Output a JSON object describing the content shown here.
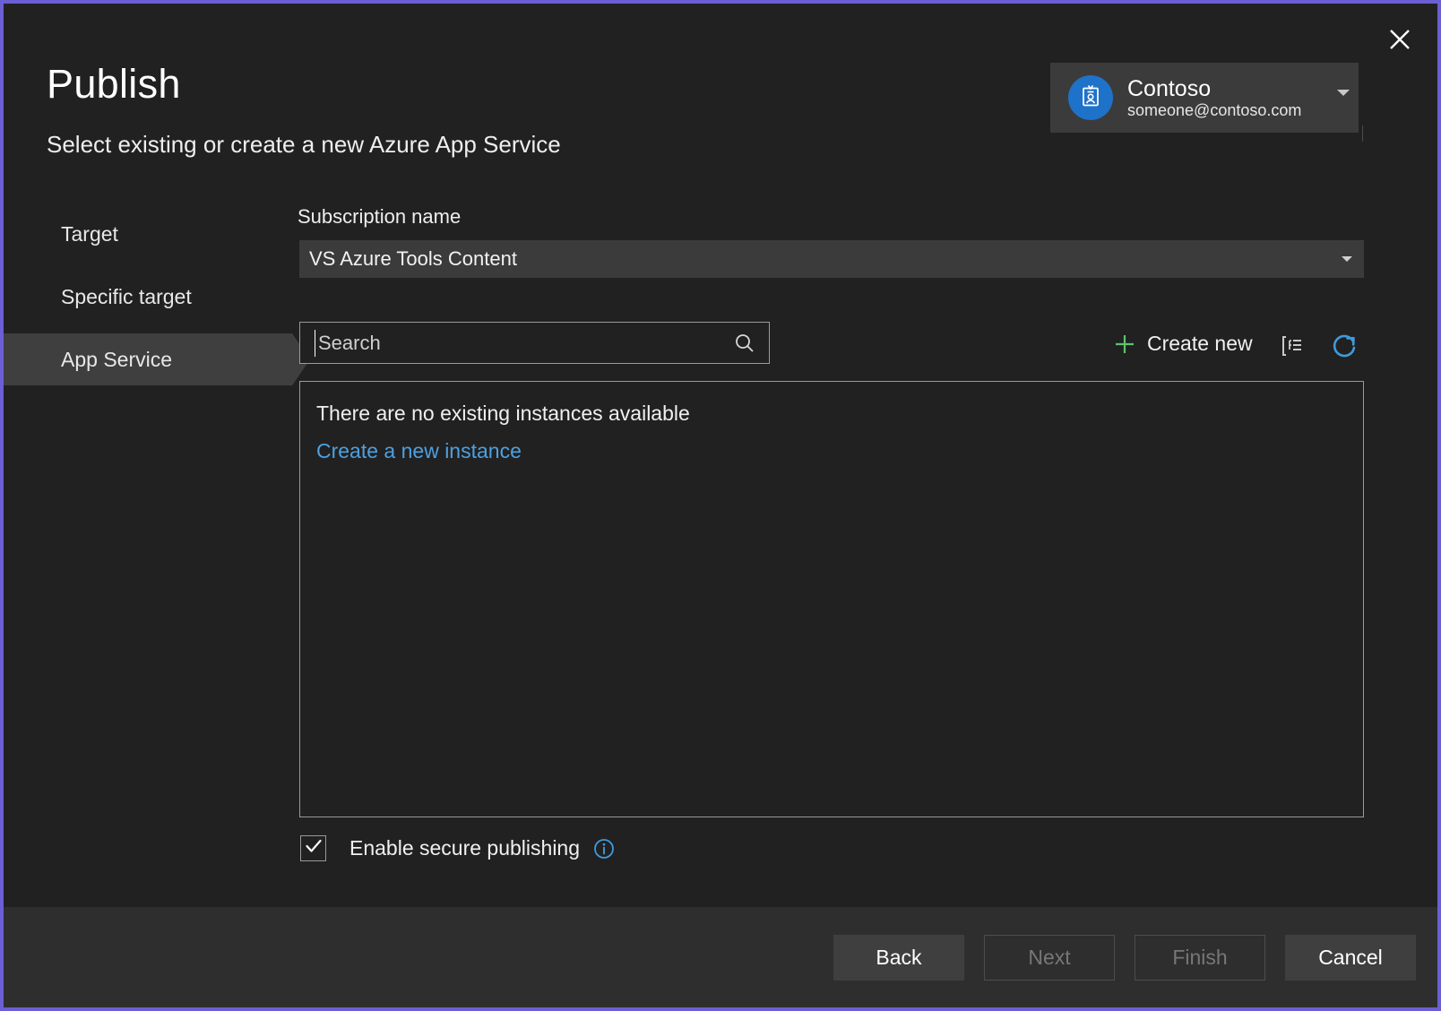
{
  "dialog": {
    "title": "Publish",
    "subtitle": "Select existing or create a new Azure App Service",
    "close_label": "Close"
  },
  "account": {
    "name": "Contoso",
    "email": "someone@contoso.com",
    "avatar_icon": "id-badge-icon",
    "caret_icon": "chevron-down-icon",
    "accent_color": "#1f72c9"
  },
  "nav": {
    "items": [
      {
        "label": "Target",
        "active": false
      },
      {
        "label": "Specific target",
        "active": false
      },
      {
        "label": "App Service",
        "active": true
      }
    ]
  },
  "subscription": {
    "label": "Subscription name",
    "value": "VS Azure Tools Content",
    "caret_icon": "chevron-down-icon"
  },
  "search": {
    "placeholder": "Search",
    "value": "",
    "icon": "search-icon"
  },
  "toolbar": {
    "create_new_label": "Create new",
    "plus_icon": "plus-icon",
    "plus_color": "#5cc46a",
    "group_icon": "group-by-icon",
    "refresh_icon": "refresh-icon",
    "refresh_color": "#3f9bdc"
  },
  "list": {
    "empty_message": "There are no existing instances available",
    "create_link": "Create a new instance",
    "link_color": "#4ea0e0"
  },
  "secure_publishing": {
    "label": "Enable secure publishing",
    "checked": true,
    "check_icon": "checkmark-icon",
    "info_icon": "info-icon",
    "info_color": "#3f9bdc"
  },
  "footer": {
    "buttons": [
      {
        "label": "Back",
        "enabled": true
      },
      {
        "label": "Next",
        "enabled": false
      },
      {
        "label": "Finish",
        "enabled": false
      },
      {
        "label": "Cancel",
        "enabled": true
      }
    ]
  }
}
